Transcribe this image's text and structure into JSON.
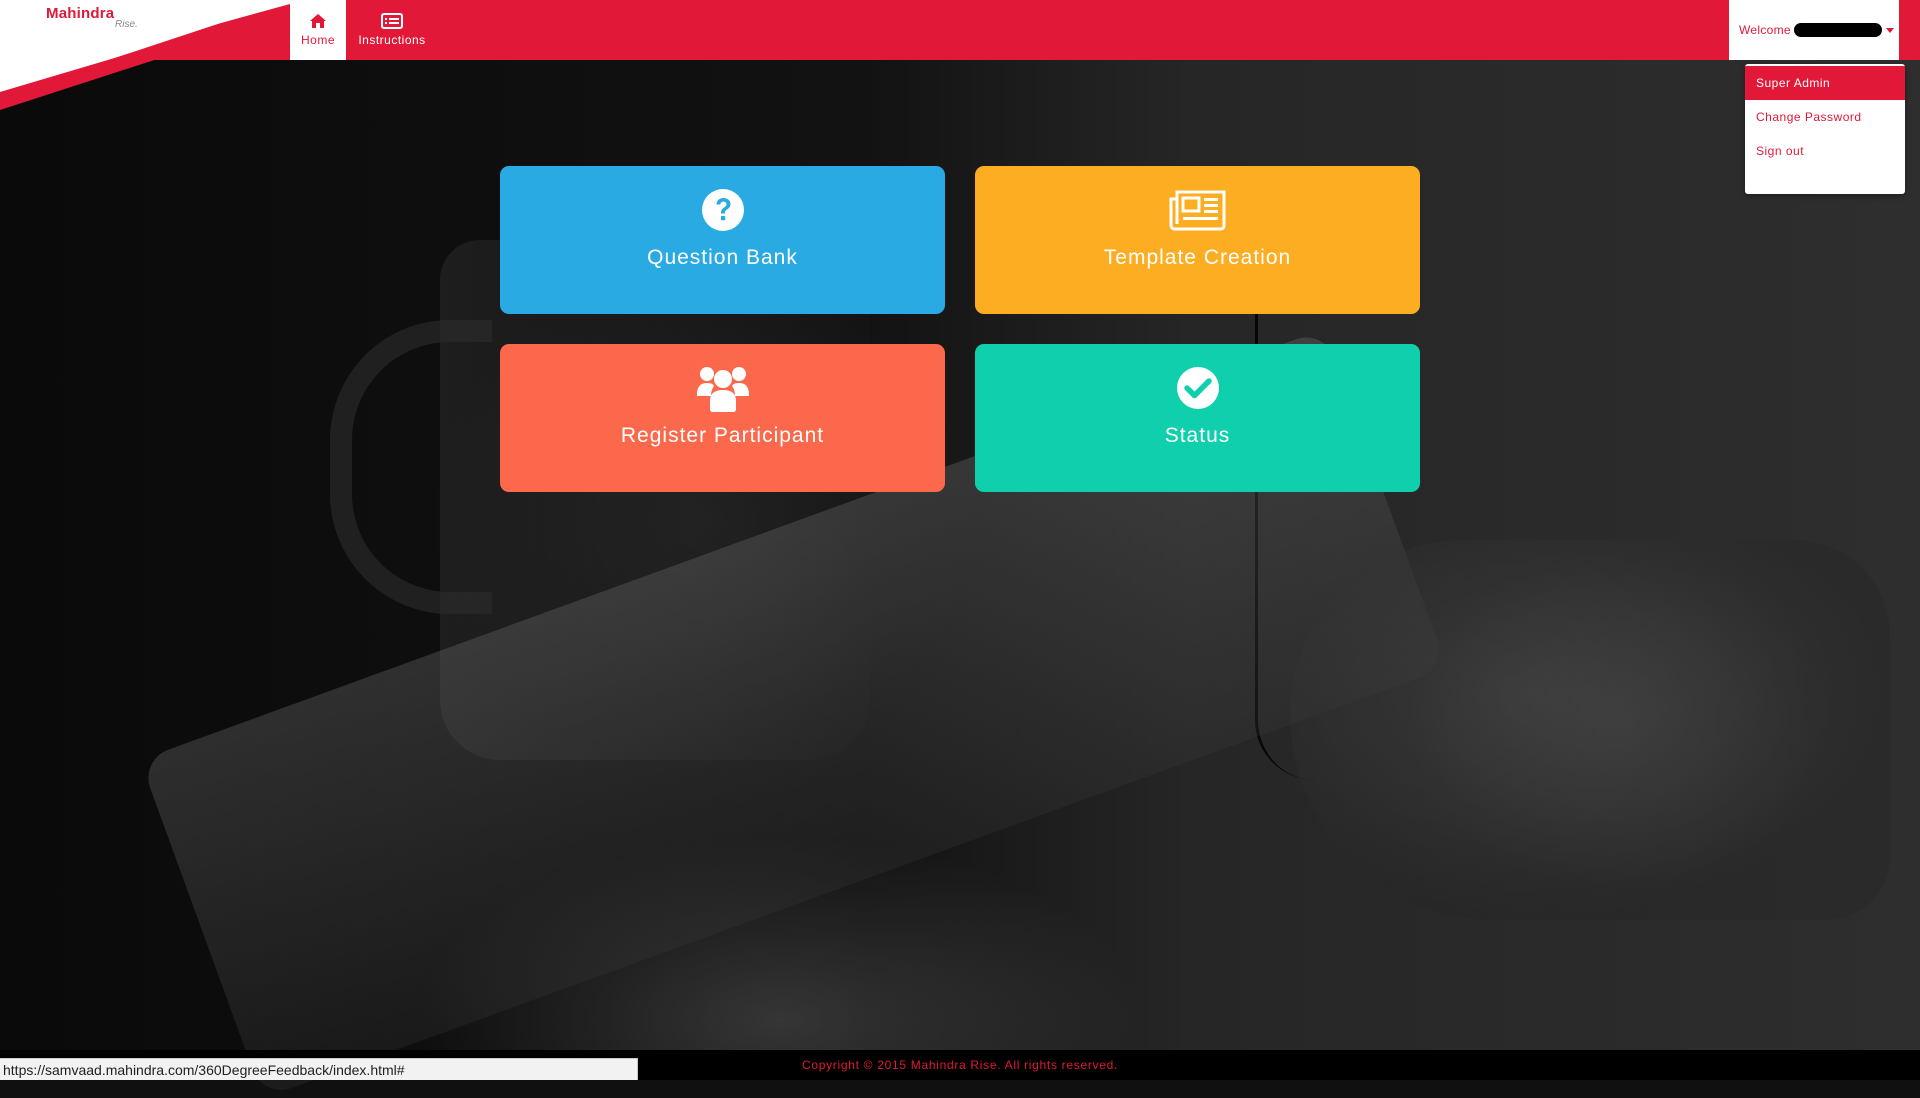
{
  "logo": {
    "name": "Mahindra",
    "tagline": "Rise."
  },
  "nav": {
    "items": [
      {
        "label": "Home",
        "icon": "home-icon",
        "active": true
      },
      {
        "label": "Instructions",
        "icon": "list-icon",
        "active": false
      }
    ]
  },
  "user": {
    "welcome_label": "Welcome",
    "menu": [
      {
        "label": "Super Admin",
        "active": true
      },
      {
        "label": "Change Password",
        "active": false
      },
      {
        "label": "Sign out",
        "active": false
      }
    ]
  },
  "tiles": [
    {
      "label": "Question Bank",
      "icon": "question-circle-icon",
      "color": "#29aae3"
    },
    {
      "label": "Template Creation",
      "icon": "newspaper-icon",
      "color": "#fdad22"
    },
    {
      "label": "Register Participant",
      "icon": "users-icon",
      "color": "#fb684b"
    },
    {
      "label": "Status",
      "icon": "check-circle-icon",
      "color": "#10cfad"
    }
  ],
  "footer": {
    "copyright": "Copyright © 2015 Mahindra Rise. All rights reserved."
  },
  "status_bar": {
    "url": "https://samvaad.mahindra.com/360DegreeFeedback/index.html#"
  },
  "colors": {
    "brand": "#e11837",
    "footer_bg": "#000000"
  }
}
